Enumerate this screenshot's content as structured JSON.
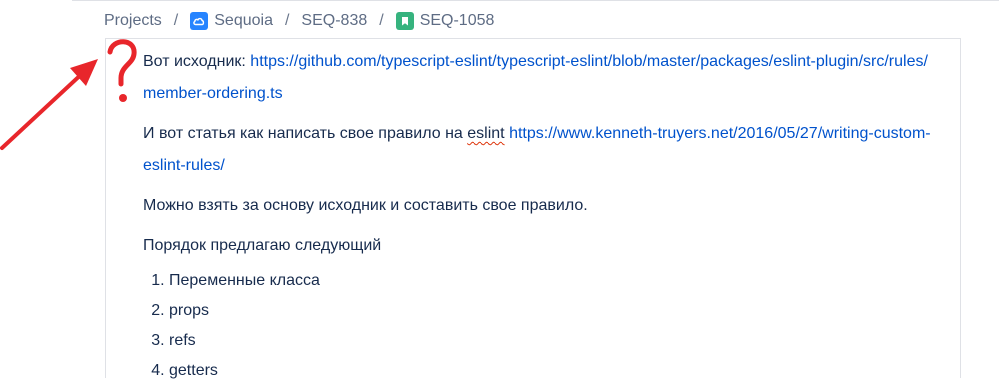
{
  "breadcrumb": {
    "items": [
      {
        "label": "Projects"
      },
      {
        "label": "Sequoia"
      },
      {
        "label": "SEQ-838"
      },
      {
        "label": "SEQ-1058"
      }
    ],
    "separator": "/"
  },
  "description": {
    "p1_text": "Вот исходник: ",
    "p1_link": "https://github.com/typescript-eslint/typescript-eslint/blob/master/packages/eslint-plugin/src/rules/member-ordering.ts",
    "p2_text_before": "И вот статья как написать свое правило на ",
    "p2_spell": "eslint",
    "p2_link": "https://www.kenneth-truyers.net/2016/05/27/writing-custom-eslint-rules/",
    "p3_text": "Можно взять за основу исходник и составить свое правило.",
    "p4_text": "Порядок предлагаю следующий",
    "list": [
      {
        "label": "Переменные класса"
      },
      {
        "label": "props"
      },
      {
        "label": "refs"
      },
      {
        "label": "getters"
      }
    ]
  },
  "annotation": {
    "glyph": "?",
    "color": "#e8262b"
  },
  "colors": {
    "link": "#0052cc",
    "text": "#172b4d",
    "breadcrumb": "#5e6c84",
    "project_icon": "#2684ff",
    "story_icon": "#36b37e"
  }
}
